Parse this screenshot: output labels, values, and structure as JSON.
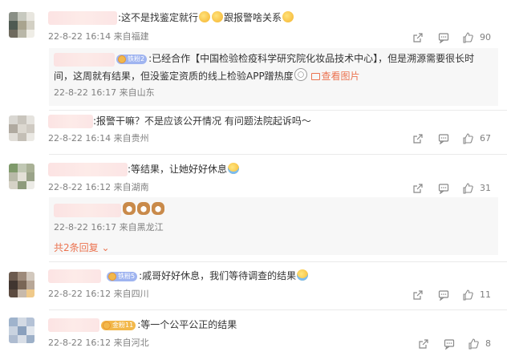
{
  "comments": [
    {
      "text_before": ":这不是找鉴定就行",
      "text_after": "跟报警啥关系",
      "time": "22-8-22 16:14",
      "location": "来自福建",
      "likes": "90",
      "reply": {
        "badge": "铁粉2",
        "text": ":已经合作【中国检验检疫科学研究院化妆品技术中心】，但是溯源需要很长时",
        "text2": "间，这周就有结果，但没鉴定资质的线上检验APP蹭热度",
        "view_image": "查看图片",
        "time": "22-8-22 16:17",
        "location": "来自山东"
      }
    },
    {
      "text": ":报警干嘛？不是应该公开情况 有问题法院起诉吗～",
      "time": "22-8-22 16:14",
      "location": "来自贵州",
      "likes": "67"
    },
    {
      "text": ":等结果，让她好好休息",
      "time": "22-8-22 16:12",
      "location": "来自湖南",
      "likes": "31",
      "reply": {
        "time": "22-8-22 16:17",
        "location": "来自黑龙江"
      },
      "more_replies": "共2条回复"
    },
    {
      "badge": "铁粉5",
      "text": ":戚哥好好休息，我们等待调查的结果",
      "time": "22-8-22 16:12",
      "location": "来自四川",
      "likes": "11"
    },
    {
      "badge": "金粉11",
      "text": ":等一个公平公正的结果",
      "time": "22-8-22 16:12",
      "location": "来自河北",
      "likes": "8"
    }
  ],
  "colors": {
    "link": "#eb7350",
    "meta": "#808080",
    "text": "#333333"
  }
}
